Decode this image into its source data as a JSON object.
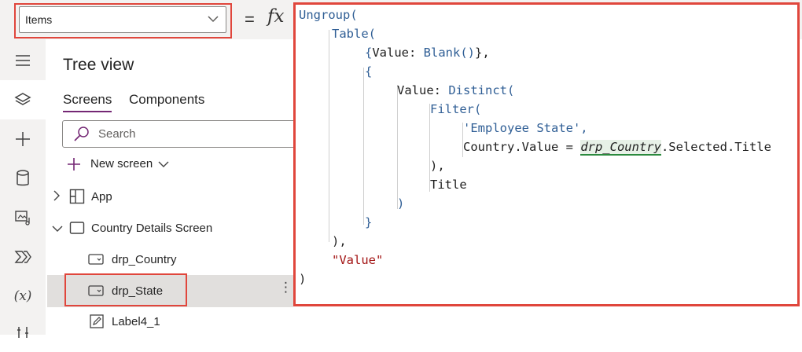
{
  "formula_bar": {
    "property": "Items",
    "equals": "=",
    "fx": "fx"
  },
  "rail": {
    "icons": [
      "hamburger-icon",
      "layers-icon",
      "plus-icon",
      "data-icon",
      "media-icon",
      "power-automate-icon",
      "variables-icon",
      "tools-icon"
    ],
    "variables_label": "(x)"
  },
  "tree_view": {
    "title": "Tree view",
    "tabs": [
      {
        "label": "Screens",
        "active": true
      },
      {
        "label": "Components",
        "active": false
      }
    ],
    "search_placeholder": "Search",
    "new_screen_label": "New screen",
    "items": [
      {
        "label": "App",
        "icon": "app-grid-icon"
      },
      {
        "label": "Country Details Screen",
        "icon": "screen-icon"
      },
      {
        "label": "drp_Country",
        "icon": "dropdown-control-icon"
      },
      {
        "label": "drp_State",
        "icon": "dropdown-control-icon",
        "selected": true
      },
      {
        "label": "Label4_1",
        "icon": "label-edit-icon"
      }
    ],
    "more_options": "⋮"
  },
  "code": {
    "l1": "Ungroup(",
    "l2": "Table(",
    "l3_open": "{",
    "l3_key": "Value: ",
    "l3_fn": "Blank()",
    "l3_close": "},",
    "l4": "{",
    "l5_key": "Value: ",
    "l5_fn": "Distinct(",
    "l6": "Filter(",
    "l7": "'Employee State',",
    "l8_a": "Country.Value = ",
    "l8_hl": "drp_Country",
    "l8_b": ".Selected.Title",
    "l9": "),",
    "l10": "Title",
    "l11": ")",
    "l12": "}",
    "l13": "),",
    "l14": "\"Value\"",
    "l15": ")"
  },
  "colors": {
    "highlight_red": "#e0463c",
    "tab_accent": "#742774",
    "function_blue": "#2f5e95",
    "string_red": "#a31515"
  }
}
